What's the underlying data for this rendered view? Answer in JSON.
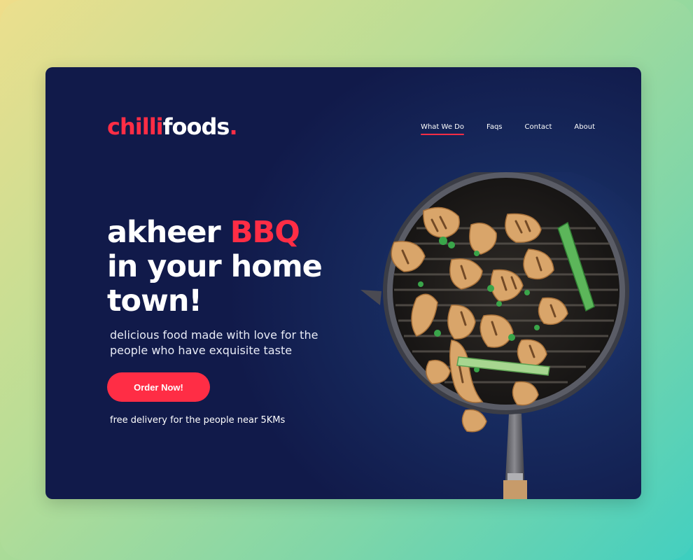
{
  "brand": {
    "logo_part1": "chilli",
    "logo_part2": "foods",
    "logo_dot": ".",
    "accent_color": "#ff2d45"
  },
  "nav": {
    "items": [
      {
        "label": "What We Do",
        "active": true
      },
      {
        "label": "Faqs"
      },
      {
        "label": "Contact"
      },
      {
        "label": "About"
      }
    ]
  },
  "hero": {
    "line1_prefix": "akheer ",
    "line1_highlight": "BBQ",
    "line2": "in your home",
    "line3": "town!",
    "subtitle": "delicious food made with love for the people who have exquisite taste",
    "cta_label": "Order Now!",
    "note": "free delivery for the people near 5KMs"
  },
  "image": {
    "subject": "grill-pan-with-bbq-chicken"
  }
}
